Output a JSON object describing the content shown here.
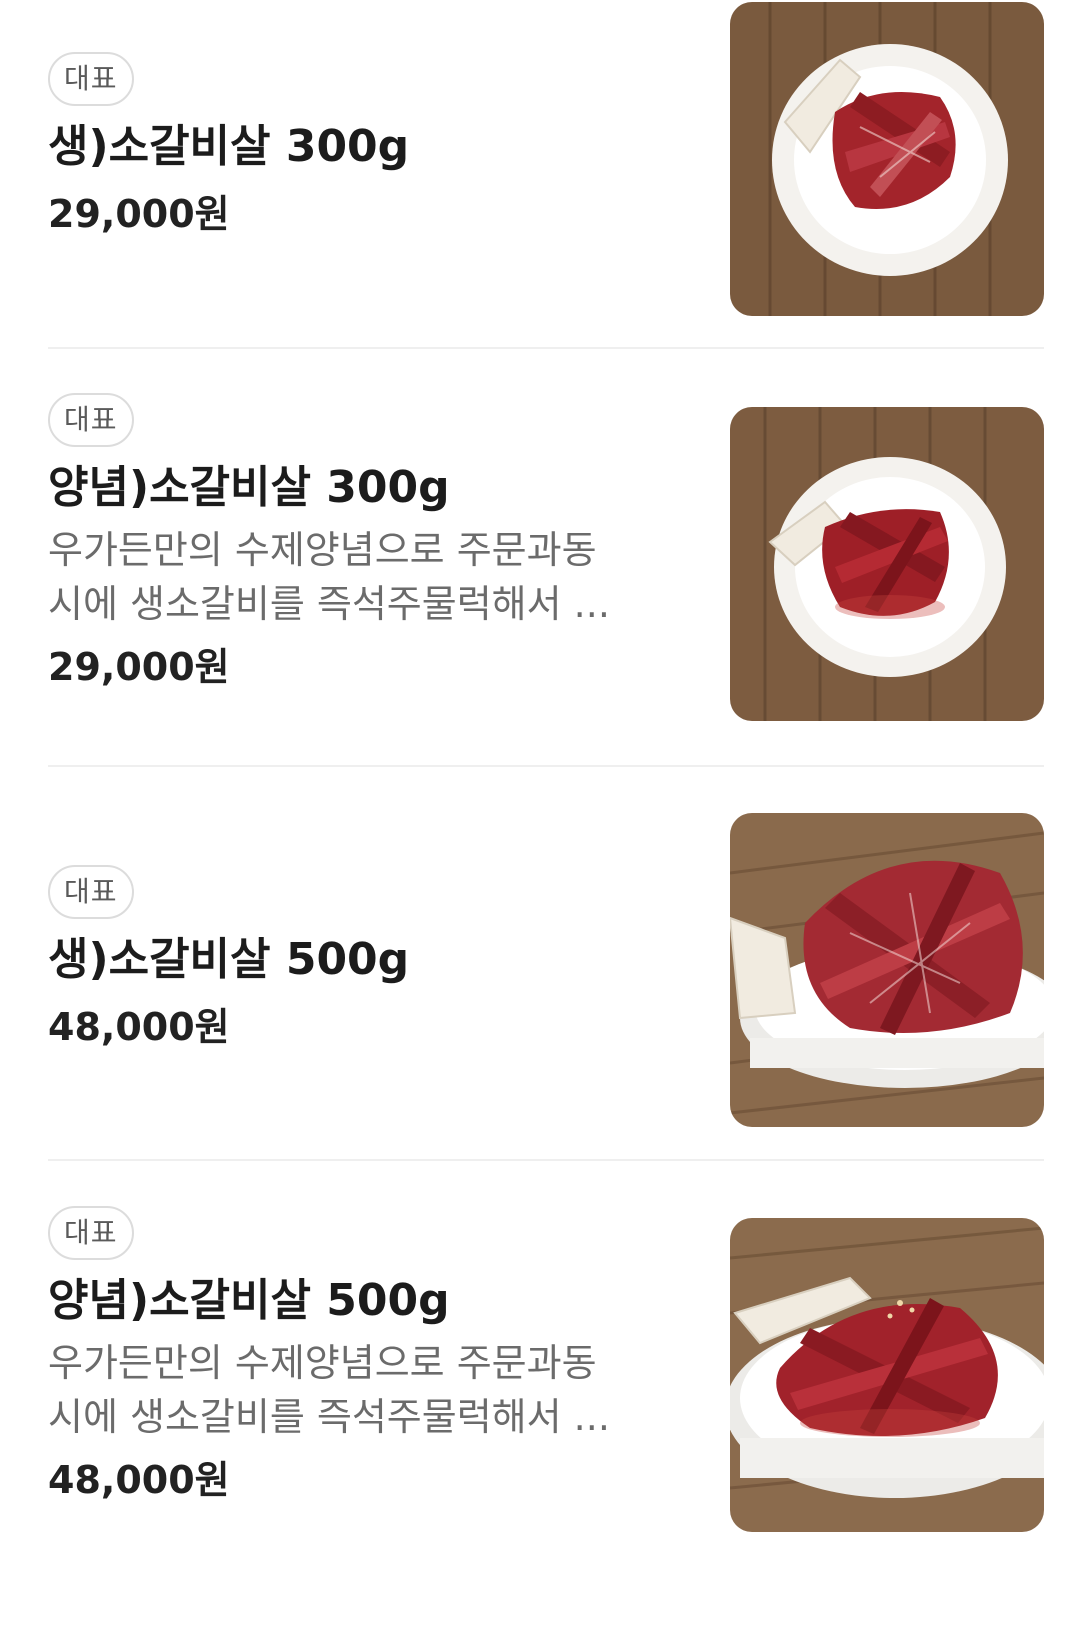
{
  "menu": {
    "items": [
      {
        "badge": "대표",
        "name": "생)소갈비살 300g",
        "price": "29,000원",
        "image_style": "raw-plate-top"
      },
      {
        "badge": "대표",
        "name": "양념)소갈비살 300g",
        "description_line1": "우가든만의 수제양념으로 주문과동",
        "description_line2": "시에 생소갈비를 즉석주물럭해서 ...",
        "price": "29,000원",
        "image_style": "marinated-plate-top"
      },
      {
        "badge": "대표",
        "name": "생)소갈비살 500g",
        "price": "48,000원",
        "image_style": "raw-plate-angled"
      },
      {
        "badge": "대표",
        "name": "양념)소갈비살 500g",
        "description_line1": "우가든만의 수제양념으로 주문과동",
        "description_line2": "시에 생소갈비를 즉석주물럭해서 ...",
        "price": "48,000원",
        "image_style": "marinated-plate-angled"
      }
    ]
  },
  "colors": {
    "text_primary": "#1c1c1c",
    "text_secondary": "#6b6b6b",
    "badge_border": "#dcdcdc",
    "divider": "#efefef",
    "wood": "#7a5a3e",
    "meat": "#a3242b"
  }
}
